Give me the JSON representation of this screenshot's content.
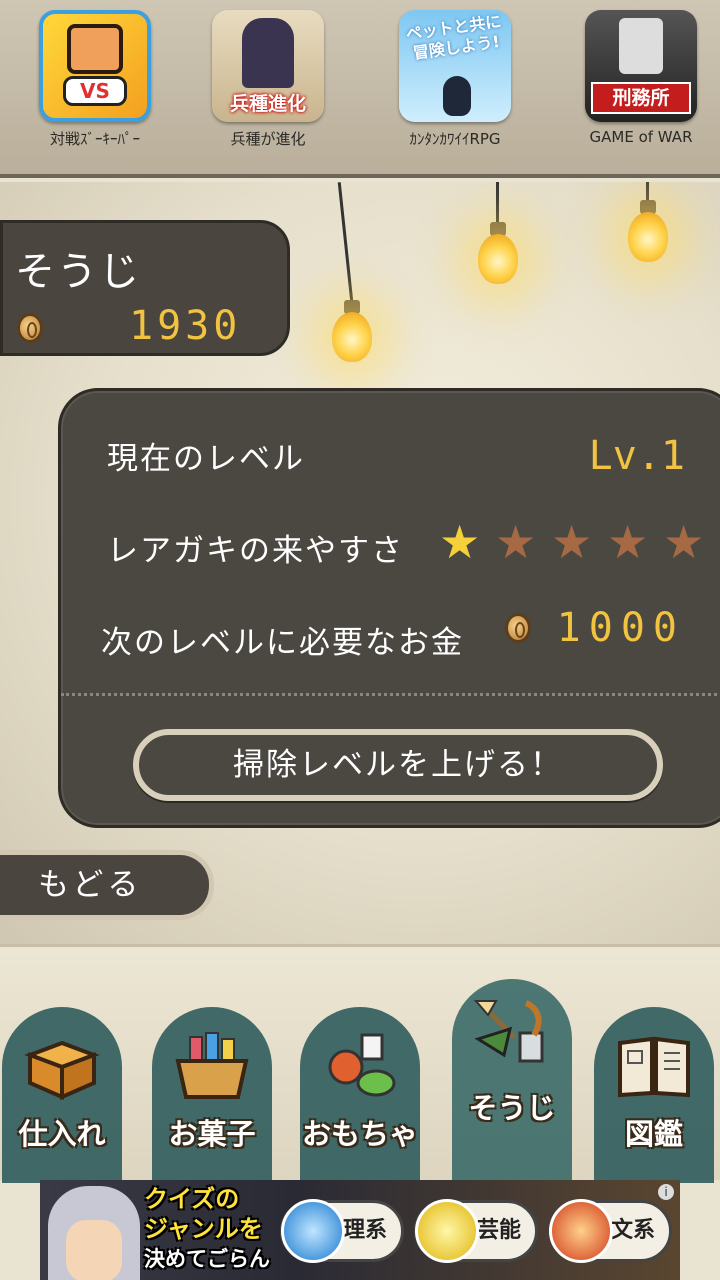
{
  "top_apps": [
    {
      "name": "対戦ｽﾞｰｷｰﾊﾟｰ",
      "icon": "vs-monkey-app-icon"
    },
    {
      "name": "兵種が進化",
      "icon": "ninja-app-icon",
      "badge": "兵種進化"
    },
    {
      "name": "ｶﾝﾀﾝｶﾜｲｲRPG",
      "icon": "penguin-app-icon",
      "badge": "ペットと共に冒険しよう!"
    },
    {
      "name": "GAME of WAR",
      "icon": "prison-app-icon",
      "badge": "刑務所"
    }
  ],
  "header": {
    "title": "そうじ",
    "money": "1930"
  },
  "info": {
    "level_label": "現在のレベル",
    "level_value": "Lv.1",
    "rare_label": "レアガキの来やすさ",
    "rare_stars_filled": 1,
    "rare_stars_total": 5,
    "next_cost_label": "次のレベルに必要なお金",
    "next_cost_value": "1000",
    "upgrade_button": "掃除レベルを上げる！"
  },
  "back_button": "もどる",
  "tabs": [
    {
      "label": "仕入れ",
      "icon": "box-icon"
    },
    {
      "label": "お菓子",
      "icon": "snack-basket-icon"
    },
    {
      "label": "おもちゃ",
      "icon": "toys-icon"
    },
    {
      "label": "そうじ",
      "icon": "cleaning-tools-icon",
      "active": true
    },
    {
      "label": "図鑑",
      "icon": "book-icon"
    }
  ],
  "ad": {
    "line1": "クイズの",
    "line2": "ジャンルを",
    "line3": "決めてごらん",
    "options": [
      "理系",
      "芸能",
      "文系"
    ]
  },
  "colors": {
    "gold": "#f2c341",
    "panel": "#4b4842",
    "star_on": "#f5d03a",
    "star_off": "#a56a44"
  }
}
